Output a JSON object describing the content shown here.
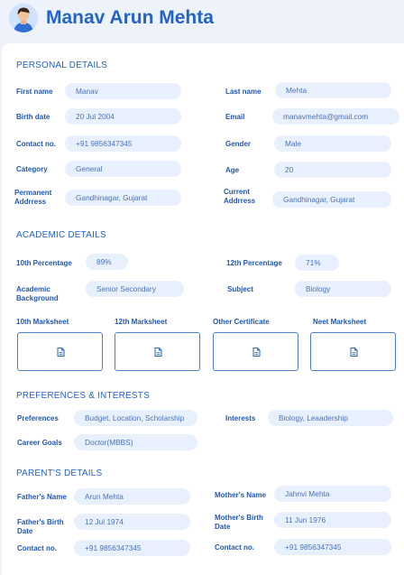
{
  "profile": {
    "name": "Manav Arun Mehta"
  },
  "personal": {
    "title": "PERSONAL DETAILS",
    "first_name": {
      "label": "First name",
      "value": "Manav"
    },
    "last_name": {
      "label": "Last name",
      "value": "Mehta"
    },
    "birth_date": {
      "label": "Birth date",
      "value": "20 Jul 2004"
    },
    "email": {
      "label": "Email",
      "value": "manavmehta@gmail.com"
    },
    "contact": {
      "label": "Contact no.",
      "value": "+91 9856347345"
    },
    "gender": {
      "label": "Gender",
      "value": "Male"
    },
    "category": {
      "label": "Category",
      "value": "General"
    },
    "age": {
      "label": "Age",
      "value": "20"
    },
    "permanent": {
      "label_line1": "Permanent",
      "label_line2": "Addrress",
      "value": "Gandhinagar, Gujarat"
    },
    "current": {
      "label_line1": "Current",
      "label_line2": "Addrress",
      "value": "Gandhinagar, Gujarat"
    }
  },
  "academic": {
    "title": "ACADEMIC DETAILS",
    "tenth": {
      "label": "10th Percentage",
      "value": "89%"
    },
    "twelfth": {
      "label": "12th Percentage",
      "value": "71%"
    },
    "background": {
      "label_line1": "Academic",
      "label_line2": "Background",
      "value": "Senior Secondary"
    },
    "subject": {
      "label": "Subject",
      "value": "Biology"
    },
    "uploads": [
      "10th  Marksheet",
      "12th Marksheet",
      "Other Certificate",
      "Neet  Marksheet"
    ]
  },
  "preferences": {
    "title": "PREFERENCES & INTERESTS",
    "preferences": {
      "label": "Preferences",
      "value": "Budget, Location, Scholarship"
    },
    "interests": {
      "label": "Interests",
      "value": "Biology, Leaadership"
    },
    "career": {
      "label": "Career Goals",
      "value": "Doctor(MBBS)"
    }
  },
  "parents": {
    "title": "PARENT'S  DETAILS",
    "father_name": {
      "label": "Father's Name",
      "value": "Arun Mehta"
    },
    "mother_name": {
      "label": "Mother's Name",
      "value": "Jahnvi Mehta"
    },
    "father_birth": {
      "label_line1": "Father's Birth",
      "label_line2": "Date",
      "value": "12 Jul 1974"
    },
    "mother_birth": {
      "label_line1": "Mother's Birth",
      "label_line2": "Date",
      "value": "11 Jun 1976"
    },
    "father_contact": {
      "label": "Contact no.",
      "value": "+91 9856347345"
    },
    "mother_contact": {
      "label": "Contact no.",
      "value": "+91 9856347345"
    }
  }
}
